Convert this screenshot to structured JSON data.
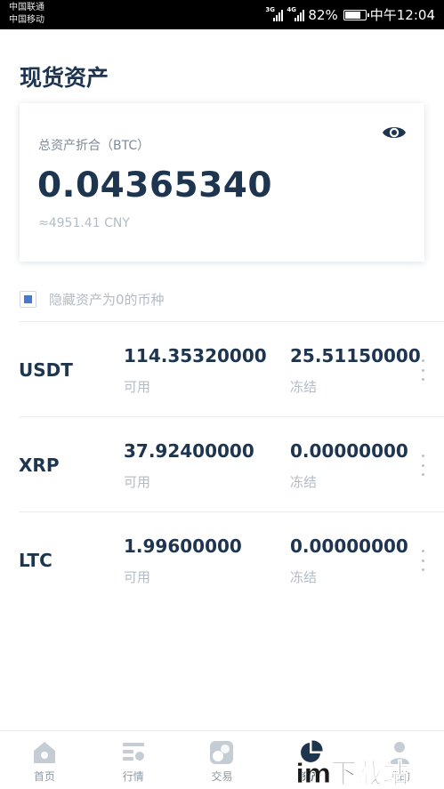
{
  "status_bar": {
    "carrier_1": "中国联通",
    "carrier_2": "中国移动",
    "network_1": "3G",
    "network_2": "4G",
    "battery_percent": "82%",
    "battery_level": 0.82,
    "time": "中午12:04"
  },
  "header": {
    "title": "现货资产"
  },
  "summary_card": {
    "label": "总资产折合（BTC）",
    "total_btc": "0.04365340",
    "cny_estimate": "≈4951.41 CNY",
    "visibility_icon": "eye-icon"
  },
  "hide_zero": {
    "label": "隐藏资产为0的币种",
    "checked": true,
    "accent_color": "#4a78d0"
  },
  "assets": [
    {
      "symbol": "USDT",
      "available": "114.35320000",
      "available_label": "可用",
      "frozen": "25.51150000",
      "frozen_label": "冻结"
    },
    {
      "symbol": "XRP",
      "available": "37.92400000",
      "available_label": "可用",
      "frozen": "0.00000000",
      "frozen_label": "冻结"
    },
    {
      "symbol": "LTC",
      "available": "1.99600000",
      "available_label": "可用",
      "frozen": "0.00000000",
      "frozen_label": "冻结"
    }
  ],
  "bottom_nav": {
    "items": [
      {
        "label": "首页",
        "icon": "home-icon",
        "active": false
      },
      {
        "label": "行情",
        "icon": "market-icon",
        "active": false
      },
      {
        "label": "交易",
        "icon": "trade-icon",
        "active": false
      },
      {
        "label": "资产",
        "icon": "asset-pie-icon",
        "active": true
      },
      {
        "label": "我的",
        "icon": "profile-icon",
        "active": false
      }
    ]
  },
  "watermark": {
    "text": "im下载站"
  },
  "colors": {
    "primary_text": "#1e3550",
    "muted_text": "#b3bcc6",
    "inactive_icon": "#c5ccd4",
    "active_icon": "#1e3550"
  }
}
